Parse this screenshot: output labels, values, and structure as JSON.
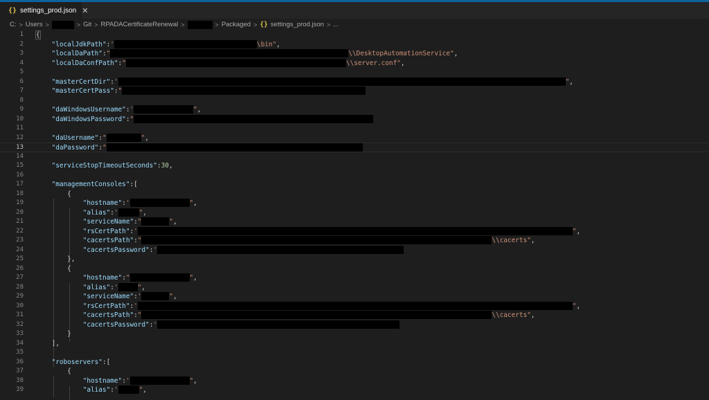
{
  "tab": {
    "icon": "{}",
    "label": "settings_prod.json",
    "close": "✕"
  },
  "breadcrumb": {
    "drive": "C:",
    "users": "Users",
    "git": "Git",
    "project": "RPADACertificateRenewal",
    "packaged": "Packaged",
    "file_icon": "{}",
    "file": "settings_prod.json",
    "more": "..."
  },
  "lines": [
    {
      "n": "1",
      "segs": [
        [
          "p",
          "{"
        ]
      ]
    },
    {
      "n": "2",
      "segs": [
        [
          "p",
          "    "
        ],
        [
          "k",
          "\"localJdkPath\""
        ],
        [
          "p",
          ":"
        ],
        [
          "s",
          "'"
        ],
        [
          "r",
          206
        ],
        [
          "s",
          "\\bin\""
        ],
        [
          "p",
          ","
        ]
      ]
    },
    {
      "n": "3",
      "segs": [
        [
          "p",
          "    "
        ],
        [
          "k",
          "\"localDaPath\""
        ],
        [
          "p",
          ":"
        ],
        [
          "s",
          "\""
        ],
        [
          "r",
          344
        ],
        [
          "s",
          "\\\\DesktopAutomationService\""
        ],
        [
          "p",
          ","
        ]
      ]
    },
    {
      "n": "4",
      "segs": [
        [
          "p",
          "    "
        ],
        [
          "k",
          "\"localDaConfPath\""
        ],
        [
          "p",
          ":"
        ],
        [
          "s",
          "\""
        ],
        [
          "r",
          318
        ],
        [
          "s",
          "\\\\server.conf\""
        ],
        [
          "p",
          ","
        ]
      ]
    },
    {
      "n": "5",
      "segs": []
    },
    {
      "n": "6",
      "segs": [
        [
          "p",
          "    "
        ],
        [
          "k",
          "\"masterCertDir\""
        ],
        [
          "p",
          ":"
        ],
        [
          "s",
          "'"
        ],
        [
          "r",
          646
        ],
        [
          "s",
          "\""
        ],
        [
          "p",
          ","
        ]
      ]
    },
    {
      "n": "7",
      "segs": [
        [
          "p",
          "    "
        ],
        [
          "k",
          "\"masterCertPass\""
        ],
        [
          "p",
          ":"
        ],
        [
          "s",
          "\""
        ],
        [
          "r",
          352
        ]
      ]
    },
    {
      "n": "8",
      "segs": []
    },
    {
      "n": "9",
      "segs": [
        [
          "p",
          "    "
        ],
        [
          "k",
          "\"daWindowsUsername\""
        ],
        [
          "p",
          ":"
        ],
        [
          "s",
          "'"
        ],
        [
          "r",
          86
        ],
        [
          "s",
          "\""
        ],
        [
          "p",
          ","
        ]
      ]
    },
    {
      "n": "10",
      "segs": [
        [
          "p",
          "    "
        ],
        [
          "k",
          "\"daWindowsPassword\""
        ],
        [
          "p",
          ":"
        ],
        [
          "s",
          "\""
        ],
        [
          "r",
          346
        ]
      ]
    },
    {
      "n": "11",
      "segs": []
    },
    {
      "n": "12",
      "segs": [
        [
          "p",
          "    "
        ],
        [
          "k",
          "\"daUsername\""
        ],
        [
          "p",
          ":"
        ],
        [
          "s",
          "\""
        ],
        [
          "r",
          50
        ],
        [
          "s",
          "\""
        ],
        [
          "p",
          ","
        ]
      ]
    },
    {
      "n": "13",
      "segs": [
        [
          "p",
          "    "
        ],
        [
          "k",
          "\"daPassword\""
        ],
        [
          "p",
          ":"
        ],
        [
          "s",
          "\""
        ],
        [
          "r",
          370
        ]
      ],
      "current": true
    },
    {
      "n": "14",
      "segs": []
    },
    {
      "n": "15",
      "segs": [
        [
          "p",
          "    "
        ],
        [
          "k",
          "\"serviceStopTimeoutSeconds\""
        ],
        [
          "p",
          ":"
        ],
        [
          "n",
          "30"
        ],
        [
          "p",
          ","
        ]
      ]
    },
    {
      "n": "16",
      "segs": []
    },
    {
      "n": "17",
      "segs": [
        [
          "p",
          "    "
        ],
        [
          "k",
          "\"managementConsoles\""
        ],
        [
          "p",
          ":["
        ]
      ]
    },
    {
      "n": "18",
      "segs": [
        [
          "p",
          "        {"
        ]
      ]
    },
    {
      "n": "19",
      "segs": [
        [
          "p",
          "            "
        ],
        [
          "k",
          "\"hostname\""
        ],
        [
          "p",
          ":"
        ],
        [
          "s",
          "'"
        ],
        [
          "r",
          86
        ],
        [
          "s",
          "\""
        ],
        [
          "p",
          ","
        ]
      ]
    },
    {
      "n": "20",
      "segs": [
        [
          "p",
          "            "
        ],
        [
          "k",
          "\"alias\""
        ],
        [
          "p",
          ":"
        ],
        [
          "s",
          "'"
        ],
        [
          "r",
          30
        ],
        [
          "s",
          "\""
        ],
        [
          "p",
          ","
        ]
      ]
    },
    {
      "n": "21",
      "segs": [
        [
          "p",
          "            "
        ],
        [
          "k",
          "\"serviceName\""
        ],
        [
          "p",
          ":"
        ],
        [
          "s",
          "\""
        ],
        [
          "r",
          40
        ],
        [
          "s",
          "\""
        ],
        [
          "p",
          ","
        ]
      ]
    },
    {
      "n": "22",
      "segs": [
        [
          "p",
          "            "
        ],
        [
          "k",
          "\"rsCertPath\""
        ],
        [
          "p",
          ":"
        ],
        [
          "s",
          "'"
        ],
        [
          "r",
          628
        ],
        [
          "s",
          "\""
        ],
        [
          "p",
          ","
        ]
      ]
    },
    {
      "n": "23",
      "segs": [
        [
          "p",
          "            "
        ],
        [
          "k",
          "\"cacertsPath\""
        ],
        [
          "p",
          ":"
        ],
        [
          "s",
          "\""
        ],
        [
          "r",
          506
        ],
        [
          "s",
          "\\\\cacerts\""
        ],
        [
          "p",
          ","
        ]
      ]
    },
    {
      "n": "24",
      "segs": [
        [
          "p",
          "            "
        ],
        [
          "k",
          "\"cacertsPassword\""
        ],
        [
          "p",
          ":"
        ],
        [
          "s",
          "'"
        ],
        [
          "r",
          356
        ]
      ]
    },
    {
      "n": "25",
      "segs": [
        [
          "p",
          "        },"
        ]
      ]
    },
    {
      "n": "26",
      "segs": [
        [
          "p",
          "        {"
        ]
      ]
    },
    {
      "n": "27",
      "segs": [
        [
          "p",
          "            "
        ],
        [
          "k",
          "\"hostname\""
        ],
        [
          "p",
          ":"
        ],
        [
          "s",
          "\""
        ],
        [
          "r",
          86
        ],
        [
          "s",
          "\""
        ],
        [
          "p",
          ","
        ]
      ]
    },
    {
      "n": "28",
      "segs": [
        [
          "p",
          "            "
        ],
        [
          "k",
          "\"alias\""
        ],
        [
          "p",
          ":"
        ],
        [
          "s",
          "'"
        ],
        [
          "r",
          28
        ],
        [
          "s",
          "\""
        ],
        [
          "p",
          ","
        ]
      ]
    },
    {
      "n": "29",
      "segs": [
        [
          "p",
          "            "
        ],
        [
          "k",
          "\"serviceName\""
        ],
        [
          "p",
          ":"
        ],
        [
          "s",
          "'"
        ],
        [
          "r",
          40
        ],
        [
          "s",
          "\""
        ],
        [
          "p",
          ","
        ]
      ]
    },
    {
      "n": "30",
      "segs": [
        [
          "p",
          "            "
        ],
        [
          "k",
          "\"rsCertPath\""
        ],
        [
          "p",
          ":"
        ],
        [
          "s",
          "'"
        ],
        [
          "r",
          628
        ],
        [
          "s",
          "\""
        ],
        [
          "p",
          ","
        ]
      ]
    },
    {
      "n": "31",
      "segs": [
        [
          "p",
          "            "
        ],
        [
          "k",
          "\"cacertsPath\""
        ],
        [
          "p",
          ":"
        ],
        [
          "s",
          "\""
        ],
        [
          "r",
          506
        ],
        [
          "s",
          "\\\\cacerts\""
        ],
        [
          "p",
          ","
        ]
      ]
    },
    {
      "n": "32",
      "segs": [
        [
          "p",
          "            "
        ],
        [
          "k",
          "\"cacertsPassword\""
        ],
        [
          "p",
          ":"
        ],
        [
          "s",
          "'"
        ],
        [
          "r",
          350
        ]
      ]
    },
    {
      "n": "33",
      "segs": [
        [
          "p",
          "        }"
        ]
      ]
    },
    {
      "n": "34",
      "segs": [
        [
          "p",
          "    ],"
        ]
      ]
    },
    {
      "n": "35",
      "segs": []
    },
    {
      "n": "36",
      "segs": [
        [
          "p",
          "    "
        ],
        [
          "k",
          "\"roboservers\""
        ],
        [
          "p",
          ":["
        ]
      ]
    },
    {
      "n": "37",
      "segs": [
        [
          "p",
          "        {"
        ]
      ]
    },
    {
      "n": "38",
      "segs": [
        [
          "p",
          "            "
        ],
        [
          "k",
          "\"hostname\""
        ],
        [
          "p",
          ":"
        ],
        [
          "s",
          "'"
        ],
        [
          "r",
          86
        ],
        [
          "s",
          "\""
        ],
        [
          "p",
          ","
        ]
      ]
    },
    {
      "n": "39",
      "segs": [
        [
          "p",
          "            "
        ],
        [
          "k",
          "\"alias\""
        ],
        [
          "p",
          ":"
        ],
        [
          "s",
          "'"
        ],
        [
          "r",
          30
        ],
        [
          "s",
          "\""
        ],
        [
          "p",
          ","
        ]
      ]
    }
  ]
}
